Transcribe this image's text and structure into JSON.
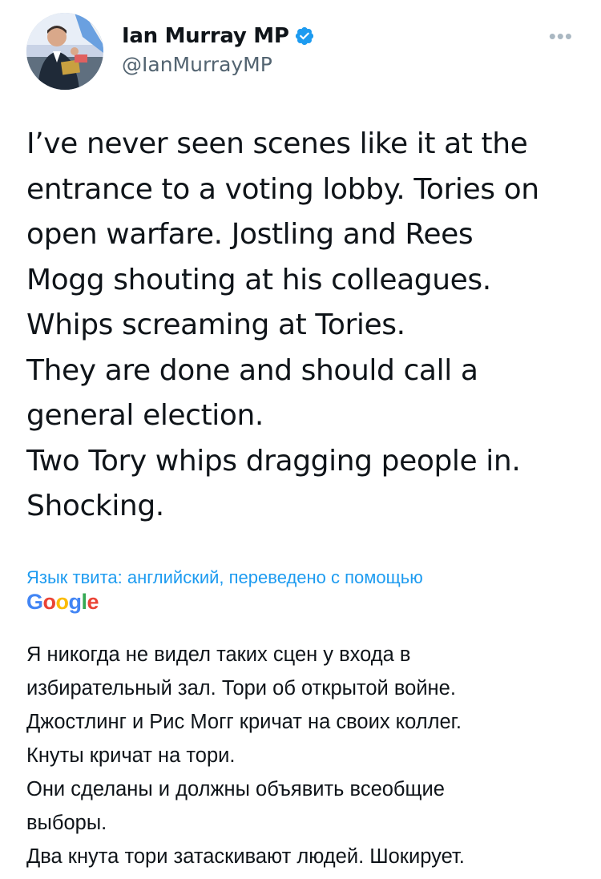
{
  "author": {
    "display_name": "Ian Murray MP",
    "handle": "@IanMurrayMP",
    "verified": true,
    "avatar": "profile-photo"
  },
  "more_icon": "more-icon",
  "tweet": {
    "text": "I’ve never seen scenes like it at the\nentrance to a voting lobby. Tories on\nopen warfare. Jostling and Rees\nMogg shouting at his colleagues.\nWhips screaming at Tories.\nThey are done and should call a\ngeneral election.\nTwo Tory whips dragging people in.\nShocking."
  },
  "translation": {
    "label": "Язык твита: английский, переведено с помощью",
    "provider": "Google",
    "text": "Я никогда не видел таких сцен у входа в\nизбирательный зал. Тори об открытой войне.\nДжостлинг и Рис Могг кричат на своих коллег.\nКнуты кричат на тори.\nОни сделаны и должны объявить всеобщие\nвыборы.\nДва кнута тори затаскивают людей. Шокирует."
  },
  "colors": {
    "link": "#1d9bf0",
    "verified": "#1d9bf0",
    "text": "#0f1419",
    "secondary": "#536471",
    "google_blue": "#4285f4",
    "google_red": "#ea4335",
    "google_yellow": "#fbbc05",
    "google_green": "#34a853"
  }
}
